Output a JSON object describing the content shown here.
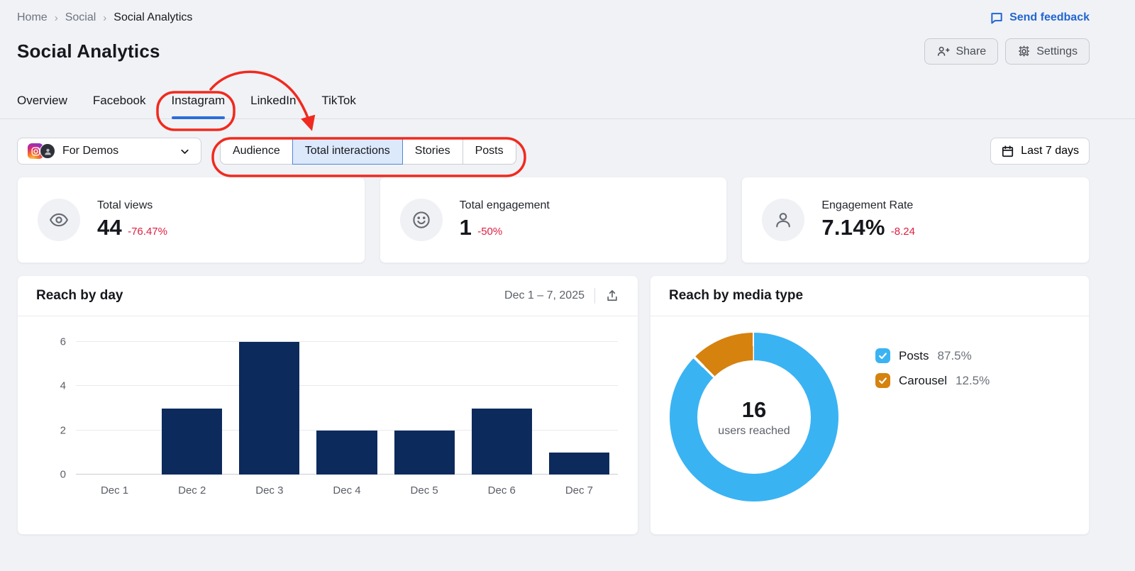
{
  "breadcrumb": {
    "items": [
      {
        "label": "Home"
      },
      {
        "label": "Social"
      },
      {
        "label": "Social Analytics"
      }
    ]
  },
  "header": {
    "title": "Social Analytics",
    "feedback_label": "Send feedback",
    "share_label": "Share",
    "settings_label": "Settings"
  },
  "tabs": [
    {
      "label": "Overview",
      "active": false
    },
    {
      "label": "Facebook",
      "active": false
    },
    {
      "label": "Instagram",
      "active": true
    },
    {
      "label": "LinkedIn",
      "active": false
    },
    {
      "label": "TikTok",
      "active": false
    }
  ],
  "filters": {
    "profile_name": "For Demos",
    "segments": [
      {
        "label": "Audience",
        "selected": false
      },
      {
        "label": "Total interactions",
        "selected": true
      },
      {
        "label": "Stories",
        "selected": false
      },
      {
        "label": "Posts",
        "selected": false
      }
    ],
    "date_range_label": "Last 7 days"
  },
  "metrics": [
    {
      "icon": "eye-icon",
      "label": "Total views",
      "value": "44",
      "delta": "-76.47%"
    },
    {
      "icon": "smiley-icon",
      "label": "Total engagement",
      "value": "1",
      "delta": "-50%"
    },
    {
      "icon": "person-icon",
      "label": "Engagement Rate",
      "value": "7.14%",
      "delta": "-8.24"
    }
  ],
  "chart_data": [
    {
      "type": "bar",
      "title": "Reach by day",
      "date_range": "Dec 1 – 7, 2025",
      "categories": [
        "Dec 1",
        "Dec 2",
        "Dec 3",
        "Dec 4",
        "Dec 5",
        "Dec 6",
        "Dec 7"
      ],
      "values": [
        0,
        3,
        6,
        2,
        2,
        3,
        1
      ],
      "ylim": [
        0,
        6
      ],
      "yticks": [
        0,
        2,
        4,
        6
      ],
      "grid": true,
      "bar_color": "#0d2a5c",
      "legend_position": "none"
    },
    {
      "type": "pie",
      "title": "Reach by media type",
      "center_value": "16",
      "center_label": "users reached",
      "slices": [
        {
          "label": "Posts",
          "pct": 87.5,
          "pct_label": "87.5%",
          "color": "#3ab3f3"
        },
        {
          "label": "Carousel",
          "pct": 12.5,
          "pct_label": "12.5%",
          "color": "#d6820f"
        }
      ],
      "legend_position": "right"
    }
  ],
  "colors": {
    "accent_blue": "#2166d1",
    "tab_underline_blue": "#2a6ed9",
    "annotation_red": "#f02a1e",
    "negative_red": "#de1f3f",
    "bar_navy": "#0d2a5c",
    "donut_blue": "#3ab3f3",
    "donut_orange": "#d6820f",
    "background": "#f1f2f6"
  }
}
